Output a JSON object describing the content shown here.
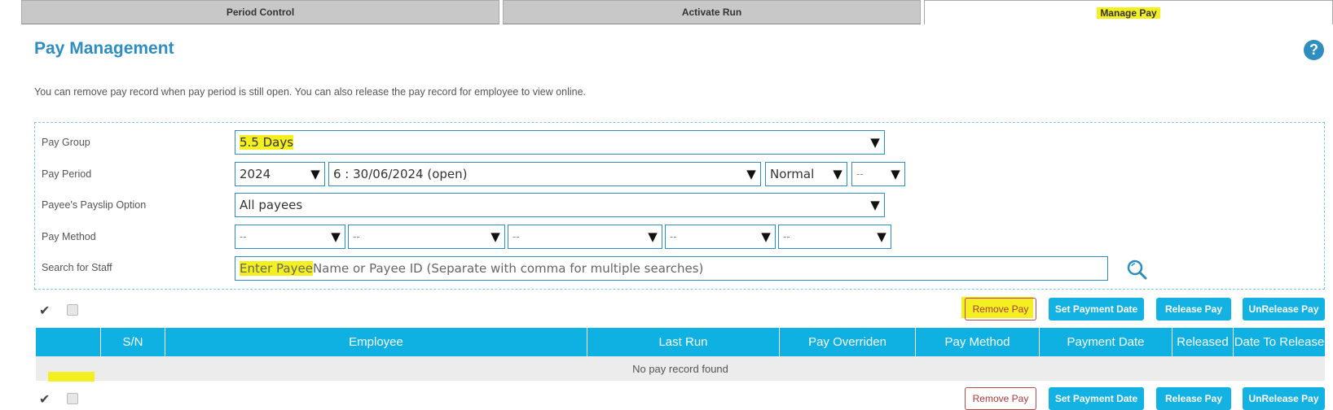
{
  "tabs": [
    {
      "label": "Period Control"
    },
    {
      "label": "Activate Run"
    },
    {
      "label": "Manage Pay",
      "active": true
    }
  ],
  "page": {
    "title": "Pay Management",
    "help_icon": "?",
    "description": "You can remove pay record when pay period is still open. You can also release the pay record for employee to view online."
  },
  "form": {
    "pay_group": {
      "label": "Pay Group",
      "value": "5.5 Days"
    },
    "pay_period": {
      "label": "Pay Period",
      "year": "2024",
      "period": "6 : 30/06/2024 (open)",
      "type": "Normal",
      "extra": "--"
    },
    "payslip_option": {
      "label": "Payee's Payslip Option",
      "value": "All payees"
    },
    "pay_method": {
      "label": "Pay Method",
      "values": [
        "--",
        "--",
        "--",
        "--",
        "--"
      ]
    },
    "search": {
      "label": "Search for Staff",
      "placeholder_highlight": "Enter Payee ",
      "placeholder_rest": "Name or Payee ID (Separate with comma for multiple searches)"
    }
  },
  "actions": {
    "remove": "Remove Pay",
    "set_date": "Set Payment Date",
    "release": "Release Pay",
    "unrelease": "UnRelease Pay",
    "check_symbol": "✔"
  },
  "table": {
    "columns": [
      "S/N",
      "Employee",
      "Last Run",
      "Pay Overriden",
      "Pay Method",
      "Payment Date",
      "Released",
      "Date To Release"
    ],
    "empty_message": "No pay record found"
  },
  "colors": {
    "accent": "#2f8dbf",
    "header": "#0fb1e2",
    "highlight": "#f4ef20"
  }
}
